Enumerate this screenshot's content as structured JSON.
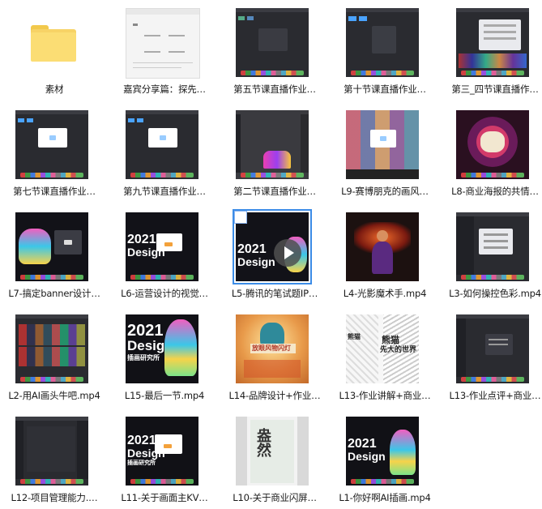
{
  "files": [
    {
      "label": "素材",
      "kind": "folder"
    },
    {
      "label": "嘉宾分享篇：探先…",
      "kind": "doc"
    },
    {
      "label": "第五节课直播作业…",
      "kind": "app"
    },
    {
      "label": "第十节课直播作业…",
      "kind": "app"
    },
    {
      "label": "第三_四节课直播作…",
      "kind": "app"
    },
    {
      "label": "第七节课直播作业…",
      "kind": "app"
    },
    {
      "label": "第九节课直播作业…",
      "kind": "app"
    },
    {
      "label": "第二节课直播作业…",
      "kind": "app"
    },
    {
      "label": "L9-赛博朋克的画风…",
      "kind": "app"
    },
    {
      "label": "L8-商业海报的共情…",
      "kind": "app"
    },
    {
      "label": "L7-搞定banner设计…",
      "kind": "app"
    },
    {
      "label": "L6-运营设计的视觉…",
      "kind": "app"
    },
    {
      "label": "L5-腾讯的笔试题IP…",
      "kind": "video",
      "selected": true
    },
    {
      "label": "L4-光影魔术手.mp4",
      "kind": "app"
    },
    {
      "label": "L3-如何操控色彩.mp4",
      "kind": "app"
    },
    {
      "label": "L2-用AI画头牛吧.mp4",
      "kind": "app"
    },
    {
      "label": "L15-最后一节.mp4",
      "kind": "poster"
    },
    {
      "label": "L14-品牌设计+作业…",
      "kind": "poster"
    },
    {
      "label": "L13-作业讲解+商业…",
      "kind": "poster"
    },
    {
      "label": "L13-作业点评+商业…",
      "kind": "app"
    },
    {
      "label": "L12-项目管理能力.…",
      "kind": "app"
    },
    {
      "label": "L11-关于画面主KV…",
      "kind": "app"
    },
    {
      "label": "L10-关于商业闪屏…",
      "kind": "poster"
    },
    {
      "label": "L1-你好啊AI插画.mp4",
      "kind": "app"
    }
  ],
  "thumb_text": {
    "year": "2021",
    "design": "Design",
    "cn_sub": "插画研究所",
    "l14_banner": "放眼风物闪灯",
    "l13_title_a": "熊猫",
    "l13_title_b": "先大的世界",
    "l10_chars": "盎然"
  },
  "colors": {
    "selection": "#3c8ce7",
    "folder": "#f7d366",
    "dialog_button": "#2e7df6"
  }
}
